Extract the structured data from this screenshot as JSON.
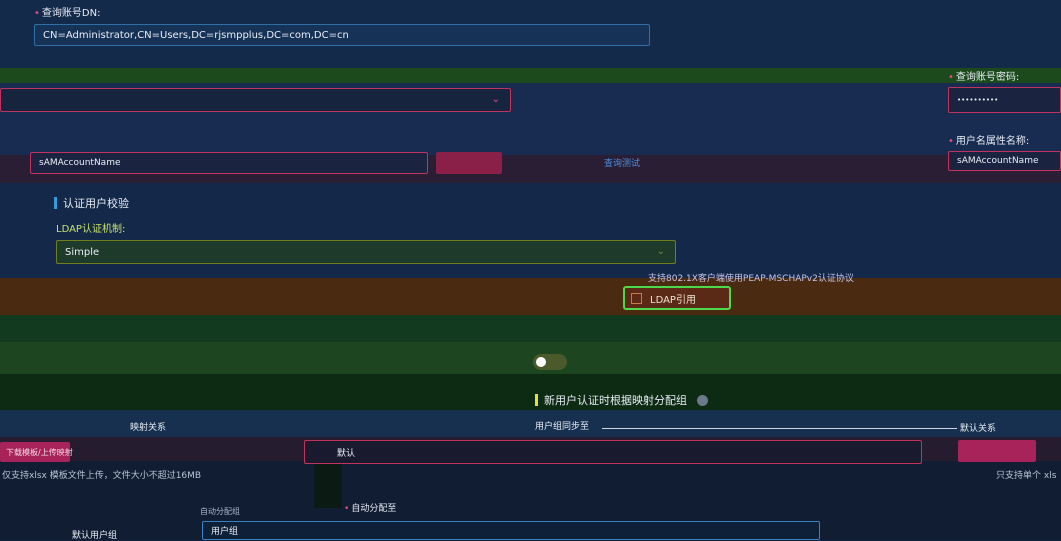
{
  "query_dn": {
    "label": "查询账号DN:",
    "value": "CN=Administrator,CN=Users,DC=rjsmpplus,DC=com,DC=cn"
  },
  "query_password": {
    "label": "查询账号密码:",
    "value": "••••••••••"
  },
  "username_attr": {
    "label": "用户名属性名称:",
    "value_left": "sAMAccountName",
    "value_right": "sAMAccountName"
  },
  "query_link": "查询测试",
  "auth_check": {
    "title": "认证用户校验",
    "mechanism_label": "LDAP认证机制:",
    "mechanism_value": "Simple"
  },
  "peap_note": "支持802.1X客户端使用PEAP-MSCHAPv2认证协议",
  "ldap_ref_label": "LDAP引用",
  "new_user_group": {
    "title": "新用户认证时根据映射分配组",
    "sync_label": "用户组同步至"
  },
  "mapping": {
    "mapping_relation": "映射关系",
    "upload_button": "下载模板/上传映射",
    "upload_hint": "仅支持xlsx 模板文件上传，文件大小不超过16MB",
    "support_hint": "只支持单个 xls",
    "default_label": "默认关系",
    "auto_assign": "自动分配至",
    "auto_rule": "自动分配组",
    "default_group": "默认用户组",
    "default_group_value": "用户组",
    "select_value": "默认"
  },
  "colors": {
    "accent": "#3a7fbf",
    "pink": "#c2325f",
    "highlight_green": "#4cd94c",
    "section_bar": "#e7e23a"
  }
}
